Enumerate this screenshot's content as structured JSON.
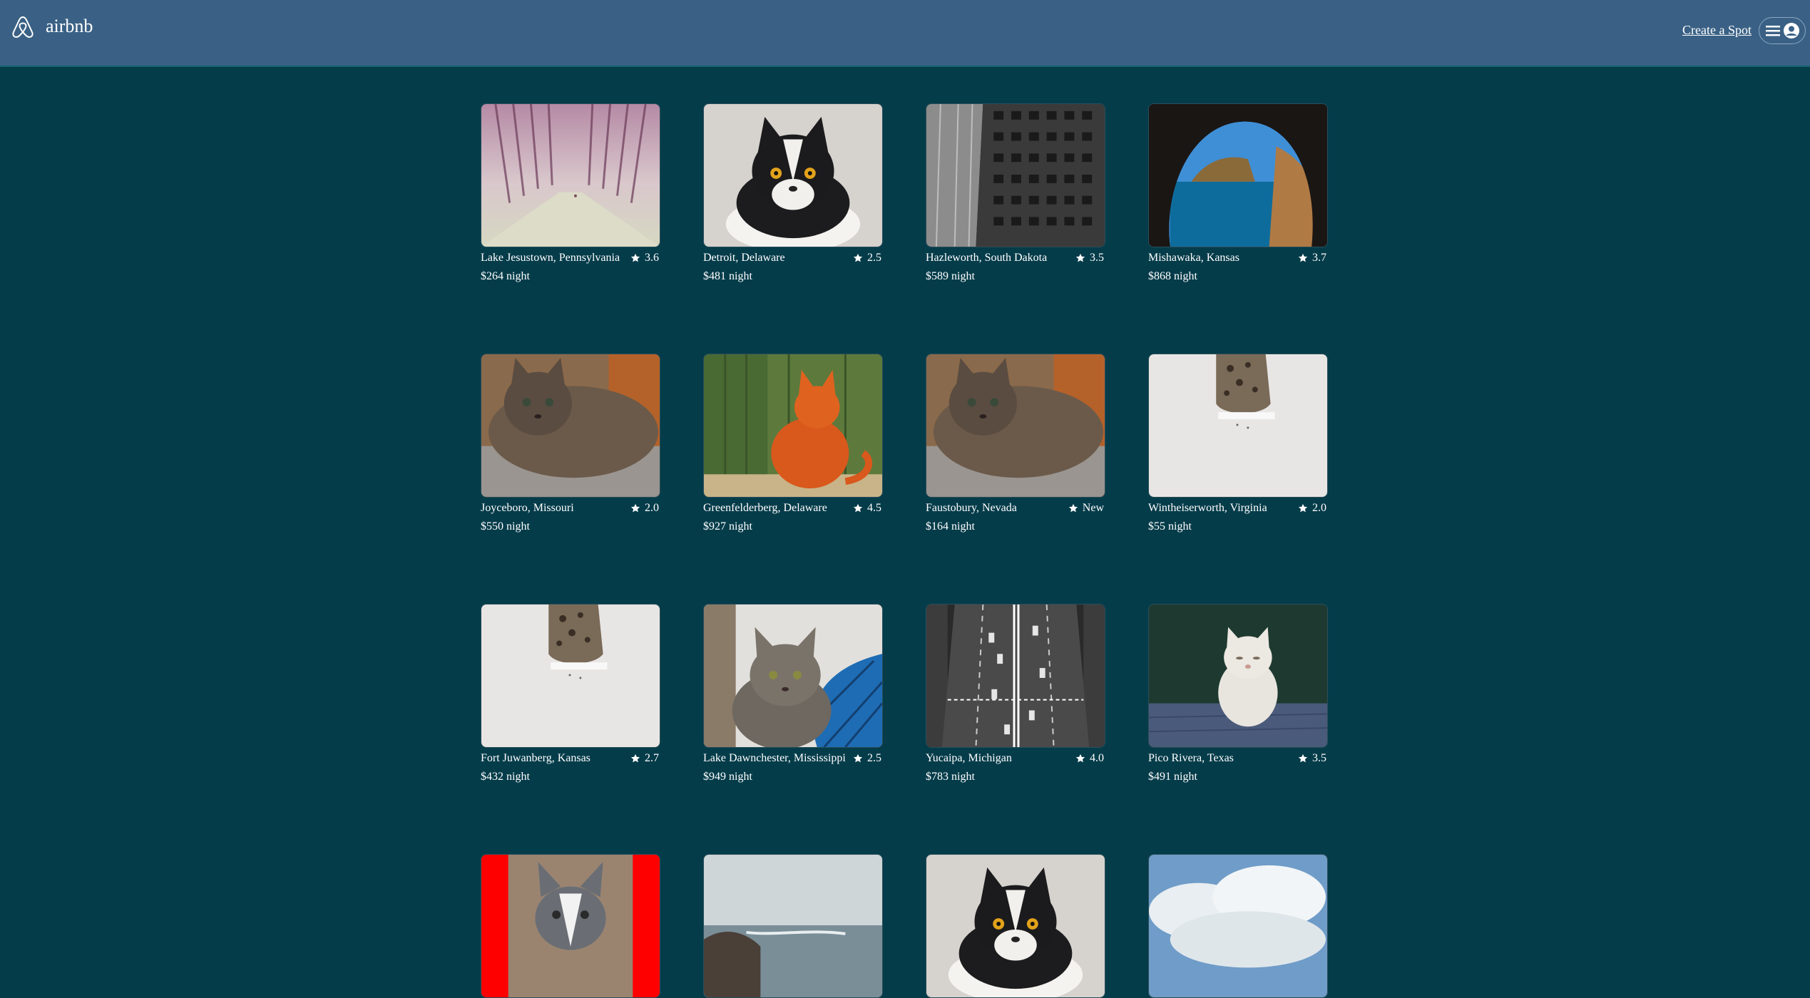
{
  "header": {
    "brand": "airbnb",
    "create_spot": "Create a Spot"
  },
  "spots": [
    {
      "location": "Lake Jesustown, Pennsylvania",
      "rating": "3.6",
      "price": "$264 night",
      "image": "misty-tree-lined-road"
    },
    {
      "location": "Detroit, Delaware",
      "rating": "2.5",
      "price": "$481 night",
      "image": "black-white-cat"
    },
    {
      "location": "Hazleworth, South Dakota",
      "rating": "3.5",
      "price": "$589 night",
      "image": "bw-building-facade"
    },
    {
      "location": "Mishawaka, Kansas",
      "rating": "3.7",
      "price": "$868 night",
      "image": "sea-cave-cliffs"
    },
    {
      "location": "Joyceboro, Missouri",
      "rating": "2.0",
      "price": "$550 night",
      "image": "fluffy-cat-on-chair"
    },
    {
      "location": "Greenfelderberg, Delaware",
      "rating": "4.5",
      "price": "$927 night",
      "image": "orange-cat-painting"
    },
    {
      "location": "Faustobury, Nevada",
      "rating": "New",
      "price": "$164 night",
      "image": "fluffy-cat-on-chair"
    },
    {
      "location": "Wintheiserworth, Virginia",
      "rating": "2.0",
      "price": "$55 night",
      "image": "cat-peeking-over-ledge"
    },
    {
      "location": "Fort Juwanberg, Kansas",
      "rating": "2.7",
      "price": "$432 night",
      "image": "cat-peeking-over-ledge"
    },
    {
      "location": "Lake Dawnchester, Mississippi",
      "rating": "2.5",
      "price": "$949 night",
      "image": "tabby-cat-blue-basket"
    },
    {
      "location": "Yucaipa, Michigan",
      "rating": "4.0",
      "price": "$783 night",
      "image": "aerial-highway-traffic"
    },
    {
      "location": "Pico Rivera, Texas",
      "rating": "3.5",
      "price": "$491 night",
      "image": "white-cat-on-deck"
    },
    {
      "location": "",
      "rating": "",
      "price": "",
      "image": "gray-kitten-red-background"
    },
    {
      "location": "",
      "rating": "",
      "price": "",
      "image": "ocean-rocks"
    },
    {
      "location": "",
      "rating": "",
      "price": "",
      "image": "black-white-cat"
    },
    {
      "location": "",
      "rating": "",
      "price": "",
      "image": "cloudy-sky"
    }
  ],
  "colors": {
    "background": "#053c4a",
    "header": "#3a6185",
    "text": "#ffffff"
  }
}
